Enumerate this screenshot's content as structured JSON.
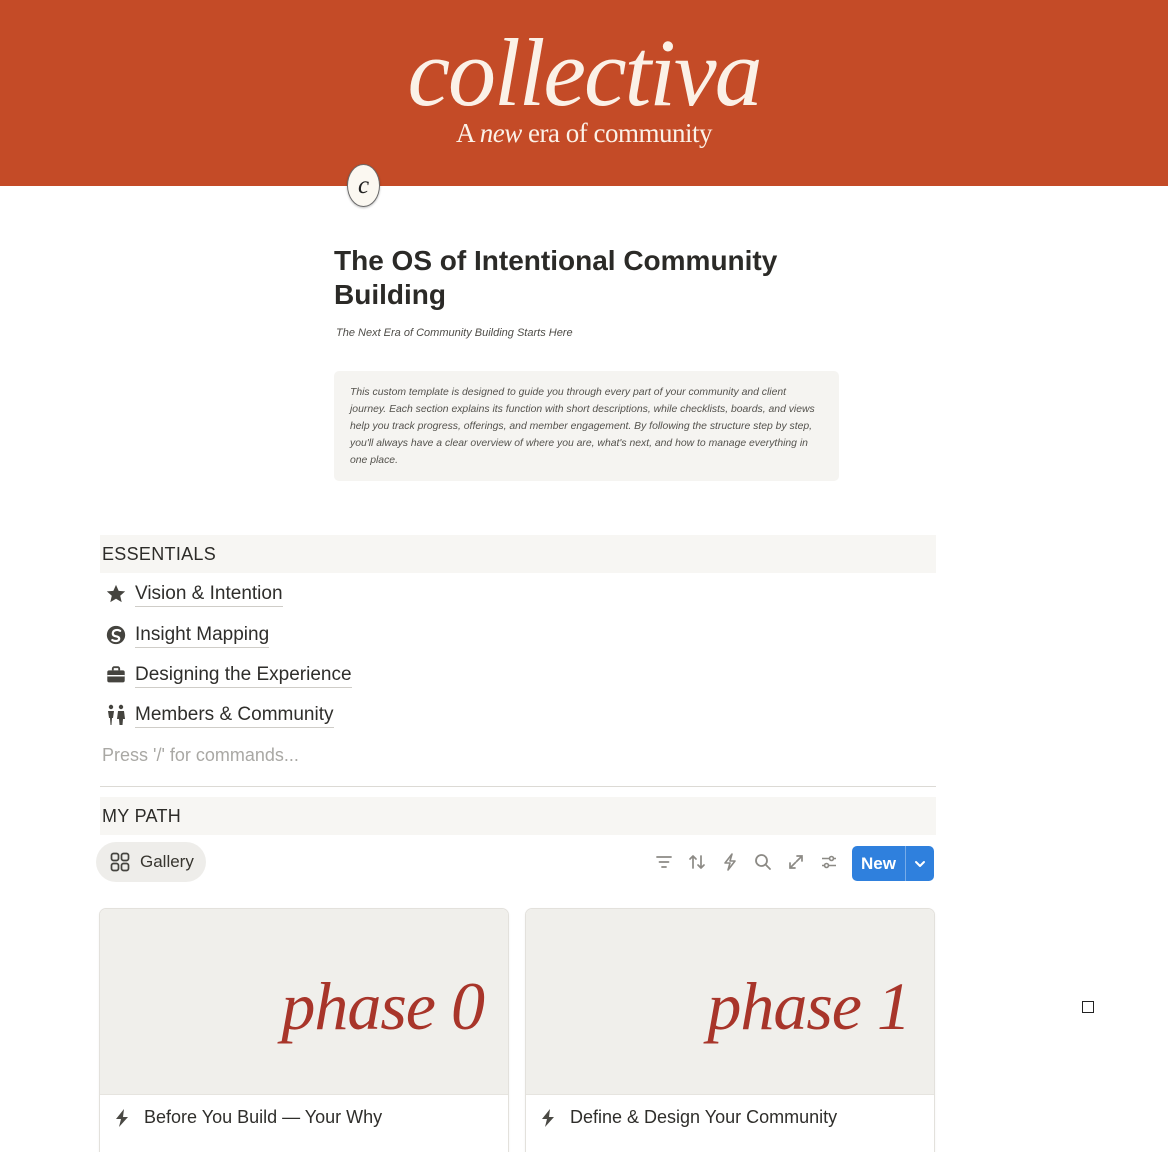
{
  "cover": {
    "brand_name": "collectiva",
    "tagline_pre": "A ",
    "tagline_em": "new",
    "tagline_post": " era of community",
    "color": "#c44b27"
  },
  "page": {
    "icon_letter": "c",
    "title": "The OS of Intentional Community Building",
    "subtitle": "The Next Era of Community Building Starts Here",
    "callout": "This custom template is designed to guide you through every part of your community and client journey. Each section explains its function with short descriptions, while checklists, boards, and views help you track progress, offerings, and member engagement. By following the structure step by step, you'll always have a clear overview of where you are, what's next, and how to manage everything in one place."
  },
  "essentials": {
    "heading": "ESSENTIALS",
    "links": [
      {
        "label": "Vision & Intention",
        "icon": "star-icon"
      },
      {
        "label": "Insight Mapping",
        "icon": "swirl-icon"
      },
      {
        "label": "Designing the Experience",
        "icon": "briefcase-icon"
      },
      {
        "label": "Members & Community",
        "icon": "people-icon"
      }
    ],
    "placeholder": "Press '/' for commands..."
  },
  "my_path": {
    "heading": "MY PATH",
    "view_tab": "Gallery",
    "toolbar_icons": [
      "filter-icon",
      "sort-icon",
      "automation-icon",
      "search-icon",
      "expand-icon",
      "settings-icon"
    ],
    "new_button": "New",
    "accent": "#2f80dd",
    "cards": [
      {
        "cover_text": "phase 0",
        "title": "Before You Build — Your Why"
      },
      {
        "cover_text": "phase 1",
        "title": "Define & Design Your Community"
      }
    ]
  }
}
